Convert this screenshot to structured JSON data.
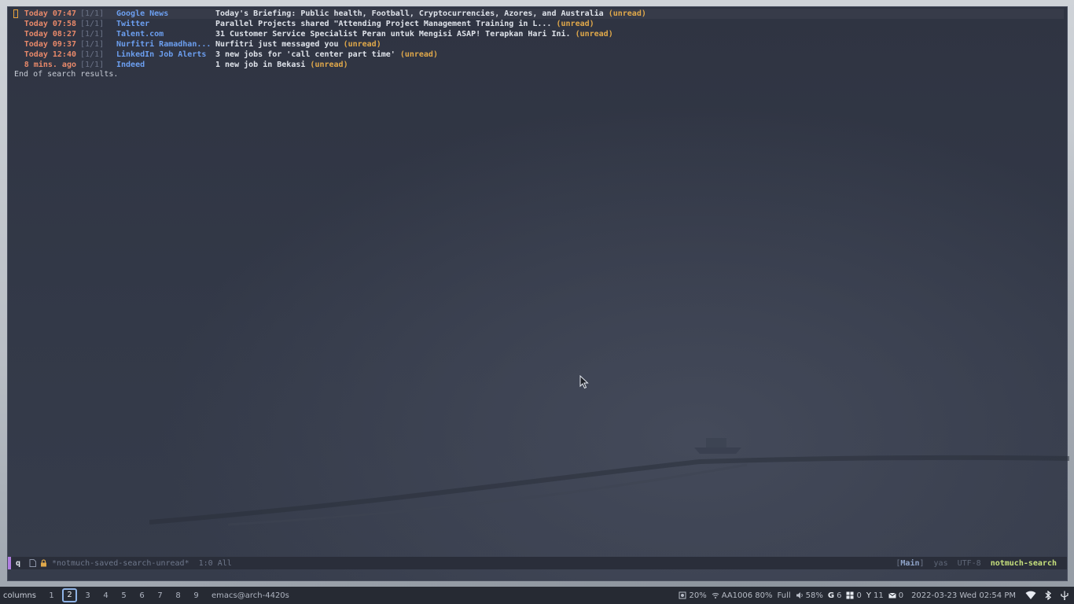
{
  "results": [
    {
      "date": "Today 07:47",
      "count": "[1/1]",
      "author": "Google News",
      "subject": "Today's Briefing: Public health, Football, Cryptocurrencies, Azores, and Australia ",
      "tag": "(unread)"
    },
    {
      "date": "Today 07:58",
      "count": "[1/1]",
      "author": "Twitter",
      "subject": "Parallel Projects shared \"Attending Project Management Training in L... ",
      "tag": "(unread)"
    },
    {
      "date": "Today 08:27",
      "count": "[1/1]",
      "author": "Talent.com",
      "subject": "31 Customer Service Specialist Peran untuk Mengisi ASAP! Terapkan Hari Ini. ",
      "tag": "(unread)"
    },
    {
      "date": "Today 09:37",
      "count": "[1/1]",
      "author": "Nurfitri Ramadhan...",
      "subject": "Nurfitri just messaged you ",
      "tag": "(unread)"
    },
    {
      "date": "Today 12:40",
      "count": "[1/1]",
      "author": "LinkedIn Job Alerts",
      "subject": "3 new jobs for 'call center part time' ",
      "tag": "(unread)"
    },
    {
      "date": "8 mins. ago",
      "count": "[1/1]",
      "author": "Indeed",
      "subject": "1 new job in Bekasi ",
      "tag": "(unread)"
    }
  ],
  "end_note": "End of search results.",
  "modeline": {
    "state": "q",
    "buffer_name": "*notmuch-saved-search-unread*",
    "position": "1:0 All",
    "workspace_open": "[",
    "workspace": "Main",
    "workspace_close": "]",
    "yas": "yas",
    "encoding": "UTF-8",
    "major_mode": "notmuch-search"
  },
  "sysbar": {
    "layout": "columns",
    "workspaces": [
      "1",
      "2",
      "3",
      "4",
      "5",
      "6",
      "7",
      "8",
      "9"
    ],
    "active_workspace": "2",
    "window_title": "emacs@arch-4420s",
    "brightness": "20%",
    "wifi": "AA1006 80%",
    "battery": "Full",
    "volume": "58%",
    "g_count": "6",
    "win_count": "0",
    "y_count": "11",
    "mail_count": "0",
    "datetime": "2022-03-23 Wed 02:54 PM"
  },
  "colors": {
    "date": "#e8896a",
    "author": "#6c9ff0",
    "subject": "#dfe3ea",
    "tag": "#e0a84a",
    "modeline_accent": "#b07ee0",
    "major_mode": "#c6e07c"
  }
}
